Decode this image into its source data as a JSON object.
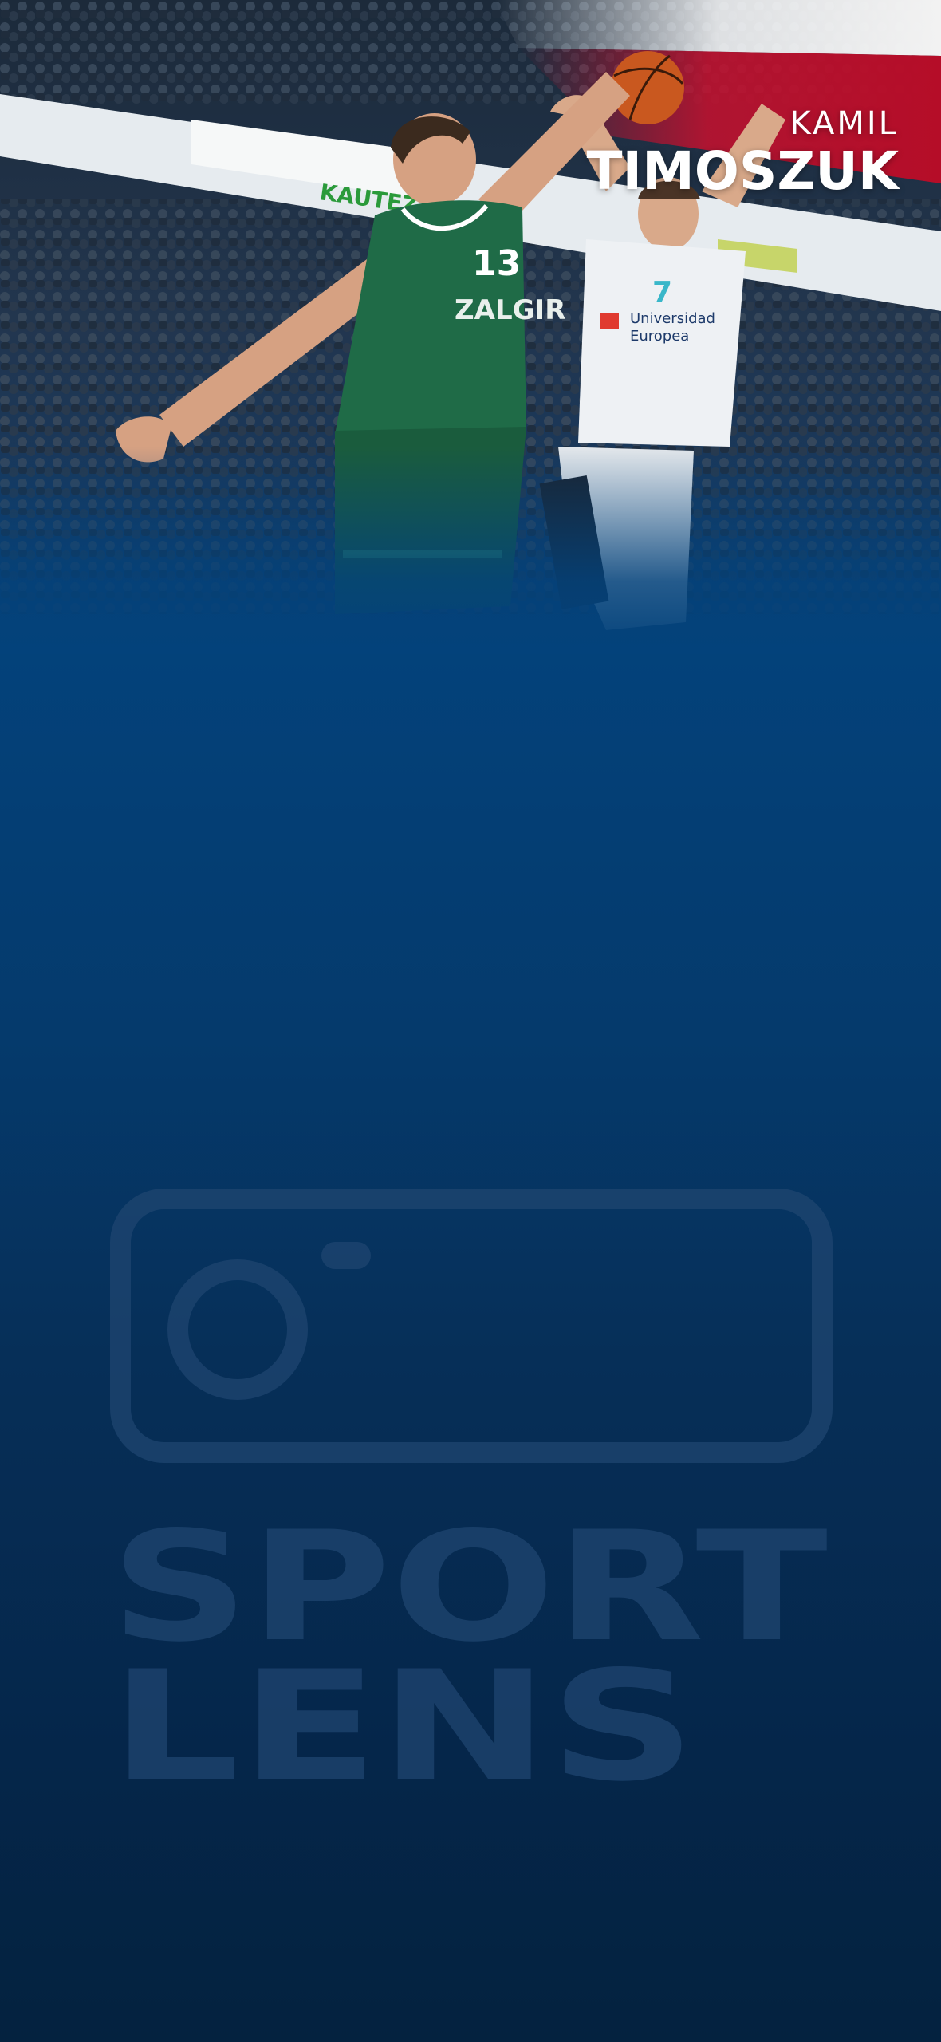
{
  "player": {
    "first_name": "KAMIL",
    "last_name": "TIMOSZUK"
  },
  "hero_photo": {
    "subject": "basketball-block-action",
    "jersey_green_number": "13",
    "jersey_green_text": "ZALGIR",
    "jersey_white_number": "7",
    "jersey_white_sponsor_line1": "Universidad",
    "jersey_white_sponsor_line2": "Europea",
    "board_text": "KAUTEZ"
  },
  "watermark": {
    "line1": "SPORT",
    "line2": "LENS"
  },
  "colors": {
    "background_top": "#0b2f5c",
    "background_mid": "#03427b",
    "background_bottom": "#04223f",
    "flag_red": "#c8102e",
    "flag_white": "#ffffff",
    "green_jersey": "#1f6b47",
    "white_jersey": "#eef1f4",
    "watermark": "#1f4570"
  }
}
